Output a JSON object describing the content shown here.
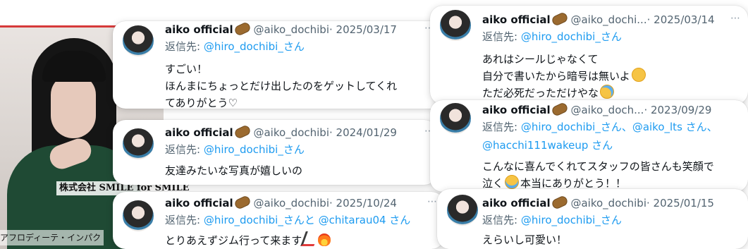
{
  "photo": {
    "caption": "株式会社 SMILE for SMILE",
    "caption2": "アフロディーテ・インパク"
  },
  "tweets": [
    {
      "name": "aiko official",
      "handle": "@aiko_dochibi",
      "date": "· 2025/03/17",
      "reply_label": "返信先: ",
      "reply_to": "@hiro_dochibi_さん",
      "text": "すごい！\nほんまにちょっとだけ出したのをゲットしてくれ\nてありがとう♡"
    },
    {
      "name": "aiko official",
      "handle": "@aiko_dochi...",
      "date": "· 2025/03/14",
      "reply_label": "返信先: ",
      "reply_to": "@hiro_dochibi_さん",
      "text_lines": [
        "あれはシールじゃなくて",
        "自分で書いたから暗号は無いよ",
        "ただ必死だっただけやな"
      ]
    },
    {
      "name": "aiko official",
      "handle": "@aiko_dochibi",
      "date": "· 2024/01/29",
      "reply_label": "返信先: ",
      "reply_to": "@hiro_dochibi_さん",
      "text": "友達みたいな写真が嬉しいの"
    },
    {
      "name": "aiko official",
      "handle": "@aiko_doch...",
      "date": "· 2023/09/29",
      "reply_label": "返信先: ",
      "reply_to": "@hiro_dochibi_さん、@aiko_lts さん、",
      "reply_to2": "@hacchi111wakeup さん",
      "text_line1": "こんなに喜んでくれてスタッフの皆さんも笑顔で",
      "text_line2a": "泣く",
      "text_line2b": "本当にありがとう！！"
    },
    {
      "name": "aiko official",
      "handle": "@aiko_dochibi",
      "date": "· 2025/10/24",
      "reply_label": "返信先: ",
      "reply_to": "@hiro_dochibi_さんと @chitarau04 さん",
      "text": "とりあえずジム行って来ます"
    },
    {
      "name": "aiko official",
      "handle": "@aiko_dochibi",
      "date": "· 2025/01/15",
      "reply_label": "返信先: ",
      "reply_to": "@hiro_dochibi_さん",
      "text": "えらいし可愛い！"
    }
  ],
  "icons": {
    "more": "⋯",
    "verified_badge": "potato-emoji",
    "relieved": "relieved-face-emoji",
    "laugh": "tears-of-joy-emoji",
    "crying": "loudly-crying-emoji",
    "runner": "running-person-emoji",
    "fire": "fire-emoji"
  }
}
